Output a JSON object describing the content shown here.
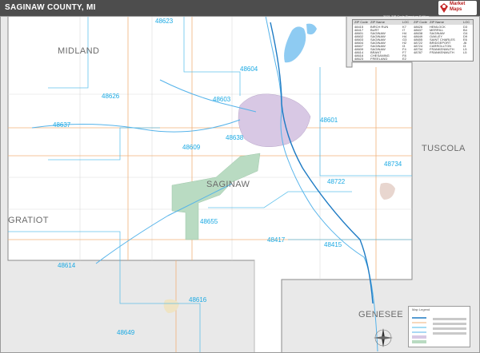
{
  "header": {
    "title": "SAGINAW COUNTY, MI",
    "logo_text": "Market Maps"
  },
  "legend": {
    "subtitle": "2021 ZIP Code Premium Edition",
    "columns": [
      "ZIP Code",
      "ZIP Name",
      "LOC",
      "ZIP Code",
      "ZIP Name",
      "LOC"
    ],
    "rows": [
      [
        "48415",
        "BIRCH RUN",
        "K7",
        "48626",
        "HEMLOCK",
        "D3"
      ],
      [
        "48417",
        "BURT",
        "I7",
        "48637",
        "MERRILL",
        "B4"
      ],
      [
        "48601",
        "SAGINAW",
        "H4",
        "48638",
        "SAGINAW",
        "G4"
      ],
      [
        "48602",
        "SAGINAW",
        "H4",
        "48649",
        "OAKLEY",
        "D9"
      ],
      [
        "48603",
        "SAGINAW",
        "G3",
        "48655",
        "SAINT CHARLES",
        "E6"
      ],
      [
        "48604",
        "SAGINAW",
        "H2",
        "48722",
        "BRIDGEPORT",
        "J6"
      ],
      [
        "48607",
        "SAGINAW",
        "I3",
        "48724",
        "CARROLLTON",
        "I3"
      ],
      [
        "48609",
        "SAGINAW",
        "F4",
        "48734",
        "FRANKENMUTH",
        "L5"
      ],
      [
        "48614",
        "BRANT",
        "F7",
        "48787",
        "FRANKENMUTH",
        "L5"
      ],
      [
        "48616",
        "CHESANING",
        "F8",
        "",
        "",
        ""
      ],
      [
        "48623",
        "FREELAND",
        "E2",
        "",
        "",
        ""
      ]
    ]
  },
  "counties": [
    {
      "name": "MIDLAND"
    },
    {
      "name": "TUSCOLA"
    },
    {
      "name": "SAGINAW"
    },
    {
      "name": "GRATIOT"
    },
    {
      "name": "GENESEE"
    }
  ],
  "zips": [
    "48623",
    "48604",
    "48626",
    "48603",
    "48601",
    "48637",
    "48638",
    "48609",
    "48734",
    "48722",
    "48655",
    "48417",
    "48415",
    "48614",
    "48616",
    "48649"
  ],
  "scale": {
    "title": "Map Legend"
  },
  "colors": {
    "header": "#4d4d4d",
    "county_fill": "#ffffff",
    "outside_fill": "#e9e9e9",
    "zip_label": "#1aa9e3",
    "water": "#8ecbf2",
    "river": "#55b3ea",
    "state_game_area": "#b9dbc2",
    "urban": "#d8c8e4"
  }
}
